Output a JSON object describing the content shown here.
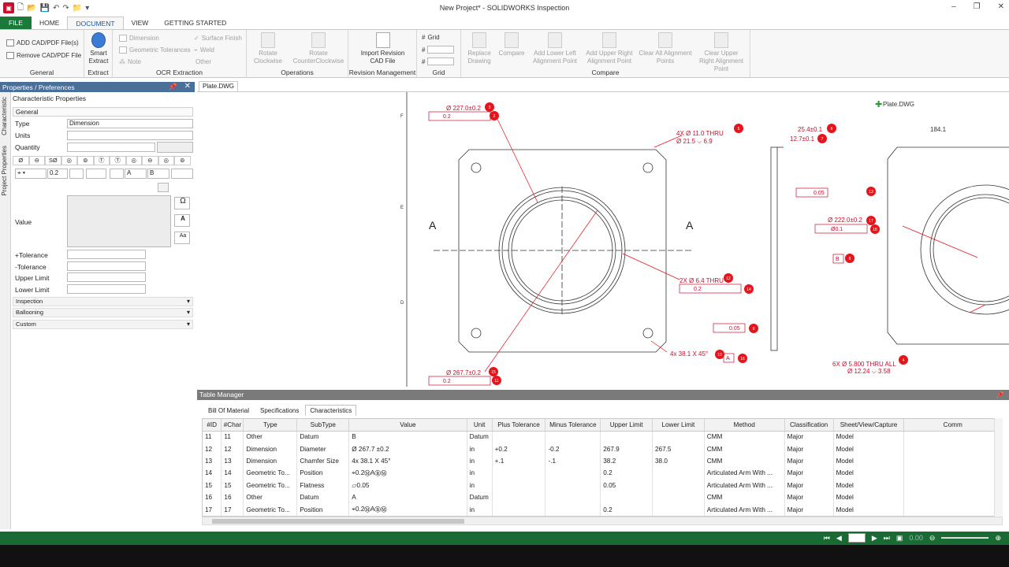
{
  "window": {
    "title": "New Project* - SOLIDWORKS Inspection"
  },
  "ribbon_tabs": [
    "FILE",
    "HOME",
    "DOCUMENT",
    "VIEW",
    "GETTING STARTED"
  ],
  "ribbon": {
    "general": {
      "label": "General",
      "add": "ADD CAD/PDF File(s)",
      "remove": "Remove CAD/PDF File"
    },
    "extract": {
      "label": "Extract",
      "smart": "Smart Extract"
    },
    "ocr": {
      "label": "OCR Extraction",
      "dimension": "Dimension",
      "gtol": "Geometric Tolerances",
      "note": "Note",
      "surface": "Surface Finish",
      "weld": "Weld",
      "other": "Other"
    },
    "operations": {
      "label": "Operations",
      "cw": "Rotate Clockwise",
      "ccw": "Rotate CounterClockwise"
    },
    "revision": {
      "label": "Revision Management",
      "import": "Import Revision CAD File"
    },
    "grid": {
      "label": "Grid",
      "grid": "Grid"
    },
    "compare": {
      "label": "Compare",
      "replace": "Replace Drawing",
      "compare": "Compare",
      "ll": "Add Lower Left Alignment Point",
      "ur": "Add Upper Right Alignment Point",
      "clear_all": "Clear All Alignment Points",
      "clear_ur": "Clear Upper Right Alignment Point"
    }
  },
  "left_panel": {
    "title": "Properties / Preferences",
    "vtabs": [
      "Characteristic",
      "Project Properties"
    ],
    "header": "Characteristic Properties",
    "general": "General",
    "type_label": "Type",
    "type_value": "Dimension",
    "units_label": "Units",
    "quantity_label": "Quantity",
    "symbols": [
      "Ø",
      "⊖",
      "SØ",
      "◎",
      "⊚",
      "Ⓣ",
      "Ⓣ",
      "◎",
      "⊖",
      "◎",
      "⊚",
      "□"
    ],
    "fcf": {
      "tol": "0.2",
      "d1": "A",
      "d2": "B"
    },
    "value_label": "Value",
    "plus_tol": "+Tolerance",
    "minus_tol": "-Tolerance",
    "upper": "Upper Limit",
    "lower": "Lower Limit",
    "sections": [
      "Inspection",
      "Ballooning",
      "Custom"
    ]
  },
  "doc_tab": "Plate.DWG",
  "drawing": {
    "file_label": "Plate.DWG",
    "row_labels": [
      "F",
      "E",
      "D"
    ],
    "section": "A",
    "dims": {
      "d1": "Ø 227.0±0.2",
      "d2": "4X Ø  11.0 THRU",
      "d3": "Ø  21.5 ⌵ 6.9",
      "d4": "2X Ø 6.4 THRU",
      "d5": "4x 38.1  X 45°",
      "d6": "Ø 267.7±0.2",
      "d7": "25.4±0.1",
      "d8": "12.7±0.1",
      "d9": "184.1",
      "d10": "Ø 222.0±0.2",
      "d11": "6X Ø  5.800 THRU ALL",
      "d12": "Ø  12.24 ⌵ 3.58",
      "fc_tol": "0.2",
      "fc_flat": "0.05",
      "fc_perp": "Ø0.1",
      "datum_a": "A",
      "datum_b": "B",
      "abb": "A B"
    },
    "balloons": [
      "3",
      "2",
      "5",
      "6",
      "7",
      "13",
      "12",
      "14",
      "15",
      "11",
      "9",
      "10",
      "16",
      "8",
      "17",
      "18",
      "4"
    ]
  },
  "table_manager": {
    "title": "Table Manager",
    "tabs": [
      "Bill Of Material",
      "Specifications",
      "Characteristics"
    ],
    "columns": [
      "#ID",
      "#Char",
      "Type",
      "SubType",
      "Value",
      "Unit",
      "Plus Tolerance",
      "Minus Tolerance",
      "Upper Limit",
      "Lower Limit",
      "Method",
      "Classification",
      "Sheet/View/Capture",
      "Comm"
    ],
    "rows": [
      [
        "11",
        "11",
        "Other",
        "Datum",
        "B",
        "Datum",
        "",
        "",
        "",
        "",
        "CMM",
        "Major",
        "Model"
      ],
      [
        "12",
        "12",
        "Dimension",
        "Diameter",
        "Ø 267.7 ±0.2",
        "in",
        "+0.2",
        "-0.2",
        "267.9",
        "267.5",
        "CMM",
        "Major",
        "Model"
      ],
      [
        "13",
        "13",
        "Dimension",
        "Chamfer Size",
        "4x 38.1  X 45°",
        "in",
        "+.1",
        "-.1",
        "38.2",
        "38.0",
        "CMM",
        "Major",
        "Model"
      ],
      [
        "14",
        "14",
        "Geometric To...",
        "Position",
        "⌖0.2ⓂAⒷⓂ",
        "in",
        "",
        "",
        "0.2",
        "",
        "Articulated Arm With ...",
        "Major",
        "Model"
      ],
      [
        "15",
        "15",
        "Geometric To...",
        "Flatness",
        "▱0.05",
        "in",
        "",
        "",
        "0.05",
        "",
        "Articulated Arm With ...",
        "Major",
        "Model"
      ],
      [
        "16",
        "16",
        "Other",
        "Datum",
        "A",
        "Datum",
        "",
        "",
        "",
        "",
        "CMM",
        "Major",
        "Model"
      ],
      [
        "17",
        "17",
        "Geometric To...",
        "Position",
        "⌖0.2ⓂAⒷⓂ",
        "in",
        "",
        "",
        "0.2",
        "",
        "Articulated Arm With ...",
        "Major",
        "Model"
      ]
    ]
  },
  "status": {
    "zoom": "0.00"
  },
  "colors": {
    "file_tab": "#1a7a3a",
    "panel_head": "#4a6f99",
    "balloon": "#e8141c",
    "status": "#1a6b33"
  }
}
